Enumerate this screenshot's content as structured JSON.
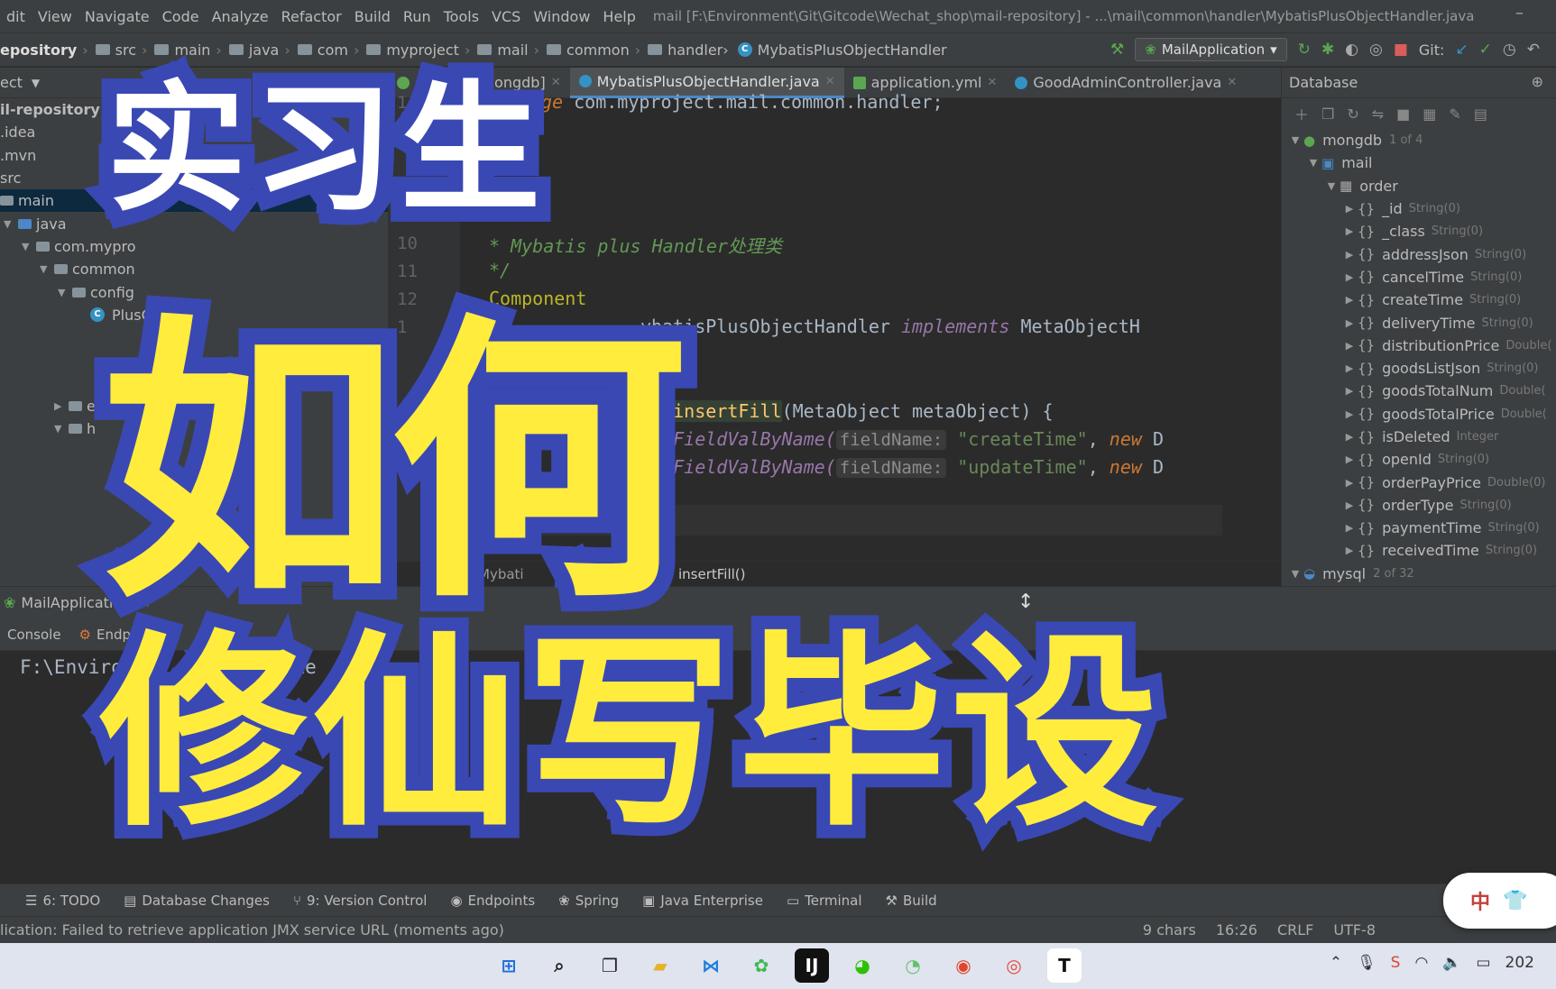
{
  "menu": {
    "items": [
      "dit",
      "View",
      "Navigate",
      "Code",
      "Analyze",
      "Refactor",
      "Build",
      "Run",
      "Tools",
      "VCS",
      "Window",
      "Help"
    ],
    "window_title": "mail [F:\\Environment\\Git\\Gitcode\\Wechat_shop\\mail-repository] - ...\\mail\\common\\handler\\MybatisPlusObjectHandler.java",
    "minimize": "–"
  },
  "breadcrumb": {
    "first": "epository",
    "items": [
      "src",
      "main",
      "java",
      "com",
      "myproject",
      "mail",
      "common",
      "handler"
    ],
    "class_name": "MybatisPlusObjectHandler",
    "sep": "›"
  },
  "toolbar": {
    "run_config": "MailApplication",
    "git_label": "Git:"
  },
  "project": {
    "header": "ect",
    "rows": [
      {
        "label": "il-repository [mail",
        "arrow": "",
        "icon": "none",
        "bold": true
      },
      {
        "label": ".idea",
        "arrow": "",
        "icon": "none"
      },
      {
        "label": ".mvn",
        "arrow": "",
        "icon": "none"
      },
      {
        "label": "src",
        "arrow": "",
        "icon": "none"
      },
      {
        "label": "main",
        "arrow": "",
        "icon": "folder",
        "selected": true
      },
      {
        "label": "java",
        "arrow": "▼",
        "icon": "blue"
      },
      {
        "label": "com.mypro",
        "arrow": "▼",
        "icon": "folder"
      },
      {
        "label": "common",
        "arrow": "▼",
        "icon": "folder"
      },
      {
        "label": "config",
        "arrow": "▼",
        "icon": "folder"
      },
      {
        "label": "PlusConfig",
        "arrow": "",
        "icon": "class"
      }
    ],
    "collapsed_rows": [
      {
        "label": "e",
        "arrow": "▶"
      },
      {
        "label": "h",
        "arrow": "▼"
      }
    ]
  },
  "editor": {
    "tabs": [
      {
        "label": "console [mongdb]",
        "active": false
      },
      {
        "label": "MybatisPlusObjectHandler.java",
        "active": true
      },
      {
        "label": "application.yml",
        "active": false
      },
      {
        "label": "GoodAdminController.java",
        "active": false
      }
    ],
    "line_numbers": [
      "1",
      "9",
      "10",
      "11",
      "12",
      "1"
    ],
    "lines": {
      "package_kw": "ge",
      "package_name": "com.myproject.mail.common.handler;",
      "doc_comment": "* Mybatis plus Handler处理类",
      "doc_end": "*/",
      "annotation": "Component",
      "class_line": "ybatisPlusObjectHandler",
      "implements_kw": "implements",
      "interface_name": "MetaObjectH",
      "void_kw": "id",
      "method_name": "insertFill",
      "method_sig": "(MetaObject metaObject) {",
      "call1": "setFieldValByName(",
      "hint": "fieldName:",
      "str1": "\"createTime\"",
      "str2": "\"updateTime\"",
      "new_kw": "new",
      "trail": "D"
    },
    "crumbs": [
      "Mybati",
      "er",
      "insertFill()"
    ]
  },
  "database": {
    "title": "Database",
    "root": {
      "label": "mongdb",
      "count": "1 of 4"
    },
    "db": "mail",
    "collection": "order",
    "fields": [
      {
        "name": "_id",
        "type": "String(0)"
      },
      {
        "name": "_class",
        "type": "String(0)"
      },
      {
        "name": "addressJson",
        "type": "String(0)"
      },
      {
        "name": "cancelTime",
        "type": "String(0)"
      },
      {
        "name": "createTime",
        "type": "String(0)"
      },
      {
        "name": "deliveryTime",
        "type": "String(0)"
      },
      {
        "name": "distributionPrice",
        "type": "Double("
      },
      {
        "name": "goodsListJson",
        "type": "String(0)"
      },
      {
        "name": "goodsTotalNum",
        "type": "Double("
      },
      {
        "name": "goodsTotalPrice",
        "type": "Double("
      },
      {
        "name": "isDeleted",
        "type": "Integer"
      },
      {
        "name": "openId",
        "type": "String(0)"
      },
      {
        "name": "orderPayPrice",
        "type": "Double(0)"
      },
      {
        "name": "orderType",
        "type": "String(0)"
      },
      {
        "name": "paymentTime",
        "type": "String(0)"
      },
      {
        "name": "receivedTime",
        "type": "String(0)"
      }
    ],
    "mysql": {
      "label": "mysql",
      "count": "2 of 32"
    }
  },
  "run": {
    "app_tab": "MailApplication",
    "tabs": [
      "Console",
      "Endpoints"
    ],
    "console_line": "F:\\Environmen  Ja    \\java.exe"
  },
  "toolstrip": {
    "items": [
      "6: TODO",
      "Database Changes",
      "9: Version Control",
      "Endpoints",
      "Spring",
      "Java Enterprise",
      "Terminal",
      "Build"
    ]
  },
  "status": {
    "message": "lication: Failed to retrieve application JMX service URL (moments ago)",
    "chars": "9 chars",
    "position": "16:26",
    "line_sep": "CRLF",
    "encoding": "UTF-8"
  },
  "ime": {
    "label": "中"
  },
  "taskbar": {
    "clock": "202"
  },
  "overlay": {
    "top": "实习生",
    "mid": "如何",
    "bot": "修仙写毕设"
  },
  "colors": {
    "overlay_stroke": "#3a48b4",
    "overlay_yellow": "#ffec3d",
    "selection": "#0d293e",
    "accent": "#4a88c7"
  }
}
